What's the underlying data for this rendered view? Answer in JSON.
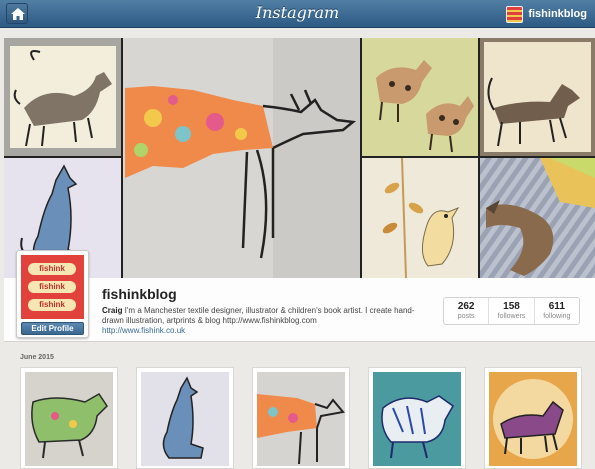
{
  "topbar": {
    "brand": "Instagram",
    "user_label": "fishinkblog"
  },
  "profile": {
    "username": "fishinkblog",
    "bio_name": "Craig",
    "bio_text": " I'm a Manchester textile designer, illustrator & children's book artist. I create hand-drawn illustration, artprints & blog http://www.fishinkblog.com",
    "website": "http://www.fishink.co.uk",
    "edit_label": "Edit Profile",
    "avatar_labels": [
      "fishink",
      "fishink",
      "fishink"
    ]
  },
  "stats": [
    {
      "value": "262",
      "label": "posts"
    },
    {
      "value": "158",
      "label": "followers"
    },
    {
      "value": "611",
      "label": "following"
    }
  ],
  "section": {
    "month": "June 2015"
  },
  "colors": {
    "topbar": "#3d6a94",
    "link": "#3a6a99",
    "avatar_red": "#e1433c"
  }
}
